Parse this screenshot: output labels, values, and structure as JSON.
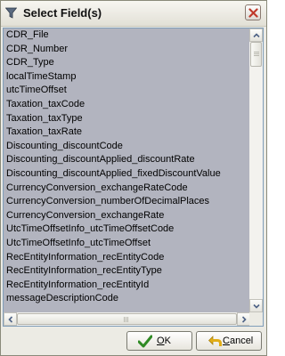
{
  "window": {
    "title": "Select Field(s)",
    "icon": "filter-icon",
    "close_icon": "close-icon"
  },
  "fields": [
    "CDR_File",
    "CDR_Number",
    "CDR_Type",
    "localTimeStamp",
    "utcTimeOffset",
    "Taxation_taxCode",
    "Taxation_taxType",
    "Taxation_taxRate",
    "Discounting_discountCode",
    "Discounting_discountApplied_discountRate",
    "Discounting_discountApplied_fixedDiscountValue",
    "CurrencyConversion_exchangeRateCode",
    "CurrencyConversion_numberOfDecimalPlaces",
    "CurrencyConversion_exchangeRate",
    "UtcTimeOffsetInfo_utcTimeOffsetCode",
    "UtcTimeOffsetInfo_utcTimeOffset",
    "RecEntityInformation_recEntityCode",
    "RecEntityInformation_recEntityType",
    "RecEntityInformation_recEntityId",
    "messageDescriptionCode"
  ],
  "buttons": {
    "ok": {
      "label": "OK",
      "icon": "checkmark-icon"
    },
    "cancel": {
      "label": "Cancel",
      "icon": "undo-arrow-icon"
    }
  },
  "colors": {
    "selection": "#b2b4bf",
    "ok_icon": "#3c9a2a",
    "cancel_icon": "#e3b21c"
  }
}
